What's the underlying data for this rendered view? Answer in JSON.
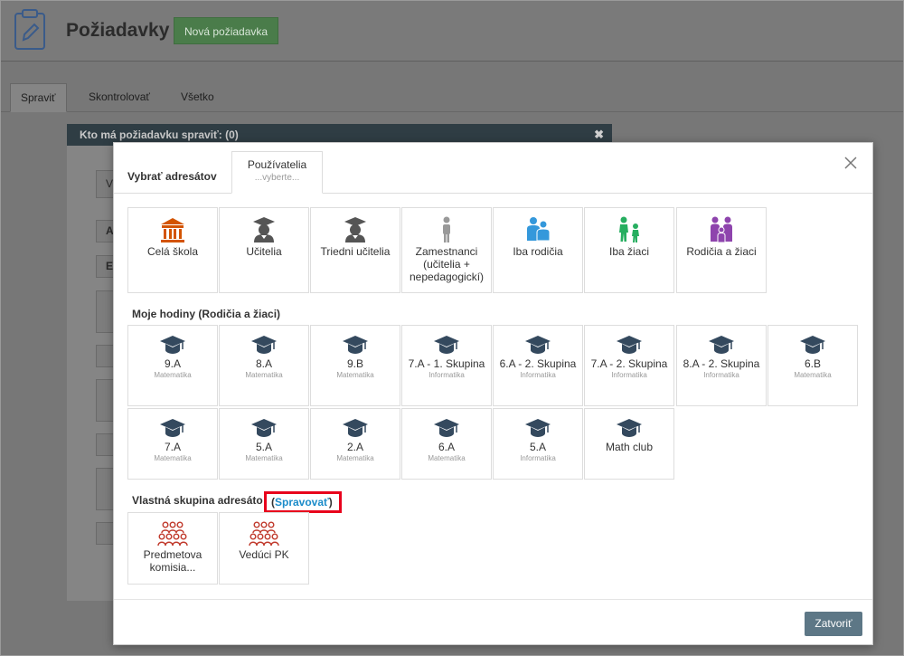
{
  "header": {
    "title": "Požiadavky",
    "new_button": "Nová požiadavka"
  },
  "tabs": [
    {
      "label": "Spraviť",
      "active": true
    },
    {
      "label": "Skontrolovať",
      "active": false
    },
    {
      "label": "Všetko",
      "active": false
    }
  ],
  "background_dialog": {
    "title": "Kto má požiadavku spraviť: (0)",
    "field_fragments": [
      "V",
      "A",
      "E"
    ]
  },
  "modal": {
    "tab_label": "Vybrať adresátov",
    "active_tab": {
      "title": "Používatelia",
      "subtitle": "...vyberte..."
    },
    "recipients": [
      {
        "label": "Celá škola",
        "icon": "school-building-icon",
        "color": "#d35400"
      },
      {
        "label": "Učitelia",
        "icon": "teacher-icon",
        "color": "#555555"
      },
      {
        "label": "Triedni učitelia",
        "icon": "teacher-icon",
        "color": "#555555"
      },
      {
        "label": "Zamestnanci (učitelia + nepedagogickí)",
        "icon": "employee-icon",
        "color": "#999999"
      },
      {
        "label": "Iba rodičia",
        "icon": "parents-icon",
        "color": "#3498db"
      },
      {
        "label": "Iba žiaci",
        "icon": "students-icon",
        "color": "#27ae60"
      },
      {
        "label": "Rodičia a žiaci",
        "icon": "family-icon",
        "color": "#8e44ad"
      }
    ],
    "my_classes_title": "Moje hodiny (Rodičia a žiaci)",
    "classes": [
      {
        "name": "9.A",
        "subject": "Matematika"
      },
      {
        "name": "8.A",
        "subject": "Matematika"
      },
      {
        "name": "9.B",
        "subject": "Matematika"
      },
      {
        "name": "7.A - 1. Skupina",
        "subject": "Informatika"
      },
      {
        "name": "6.A - 2. Skupina",
        "subject": "Informatika"
      },
      {
        "name": "7.A - 2. Skupina",
        "subject": "Informatika"
      },
      {
        "name": "8.A - 2. Skupina",
        "subject": "Informatika"
      },
      {
        "name": "6.B",
        "subject": "Matematika"
      },
      {
        "name": "7.A",
        "subject": "Matematika"
      },
      {
        "name": "5.A",
        "subject": "Matematika"
      },
      {
        "name": "2.A",
        "subject": "Matematika"
      },
      {
        "name": "6.A",
        "subject": "Matematika"
      },
      {
        "name": "5.A",
        "subject": "Informatika"
      },
      {
        "name": "Math club",
        "subject": ""
      }
    ],
    "custom_group_title": "Vlastná skupina adresáto",
    "manage_link": {
      "open": "(",
      "text": "Spravovať",
      "close": ")"
    },
    "custom_groups": [
      {
        "label": "Predmetova komisia..."
      },
      {
        "label": "Vedúci PK"
      }
    ],
    "close_button": "Zatvoriť"
  },
  "colors": {
    "accent": "#5d7786",
    "link": "#1a8bc9",
    "highlight": "#e8001c",
    "grad_cap": "#34495e",
    "group": "#c0392b"
  }
}
